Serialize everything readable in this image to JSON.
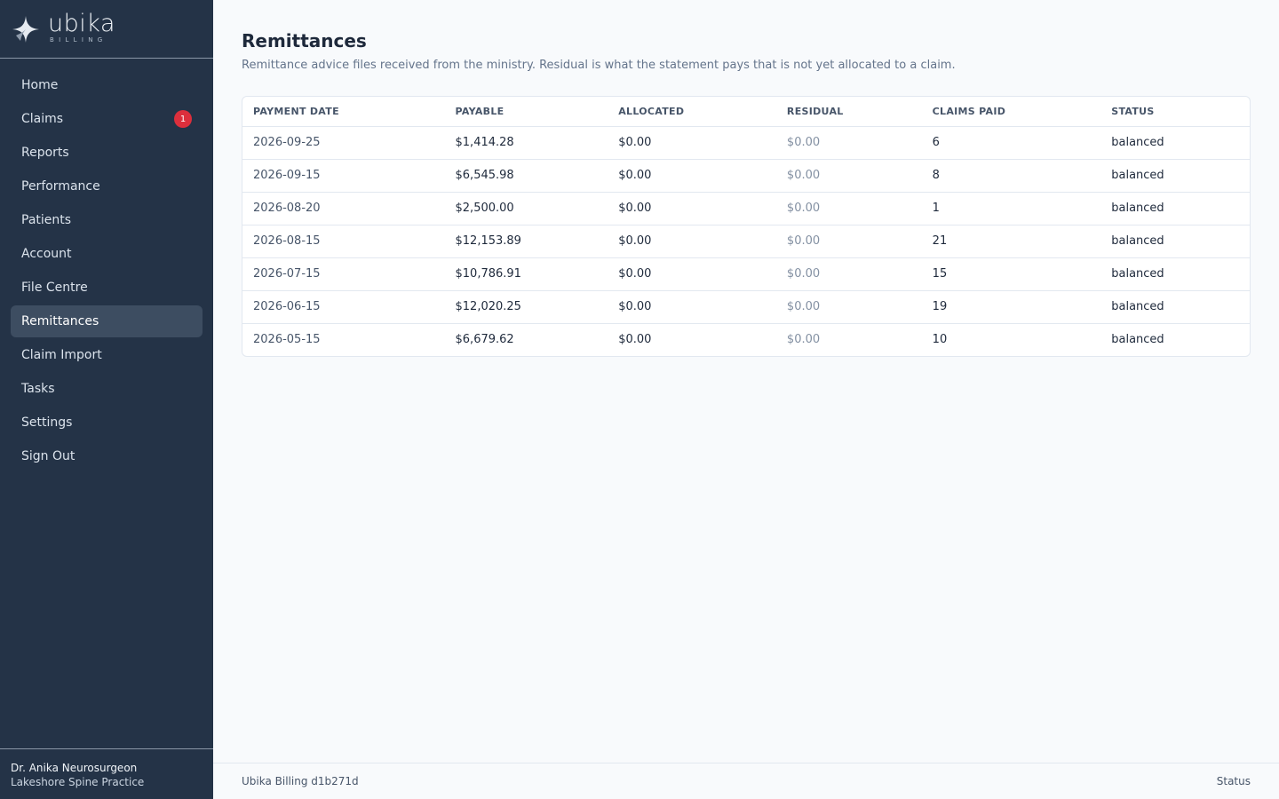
{
  "brand": {
    "name": "ubika",
    "sub": "BILLING"
  },
  "sidebar": {
    "items": [
      {
        "label": "Home",
        "name": "sidebar-item-home"
      },
      {
        "label": "Claims",
        "name": "sidebar-item-claims",
        "badge": "1"
      },
      {
        "label": "Reports",
        "name": "sidebar-item-reports"
      },
      {
        "label": "Performance",
        "name": "sidebar-item-performance"
      },
      {
        "label": "Patients",
        "name": "sidebar-item-patients"
      },
      {
        "label": "Account",
        "name": "sidebar-item-account"
      },
      {
        "label": "File Centre",
        "name": "sidebar-item-file-centre"
      },
      {
        "label": "Remittances",
        "name": "sidebar-item-remittances",
        "active": true
      },
      {
        "label": "Claim Import",
        "name": "sidebar-item-claim-import"
      },
      {
        "label": "Tasks",
        "name": "sidebar-item-tasks"
      },
      {
        "label": "Settings",
        "name": "sidebar-item-settings"
      },
      {
        "label": "Sign Out",
        "name": "sidebar-item-sign-out"
      }
    ]
  },
  "user": {
    "name": "Dr. Anika Neurosurgeon",
    "practice": "Lakeshore Spine Practice"
  },
  "page": {
    "title": "Remittances",
    "subtitle": "Remittance advice files received from the ministry. Residual is what the statement pays that is not yet allocated to a claim."
  },
  "table": {
    "columns": [
      "PAYMENT DATE",
      "PAYABLE",
      "ALLOCATED",
      "RESIDUAL",
      "CLAIMS PAID",
      "STATUS"
    ],
    "rows": [
      [
        "2026-09-25",
        "$1,414.28",
        "$0.00",
        "$0.00",
        "6",
        "balanced"
      ],
      [
        "2026-09-15",
        "$6,545.98",
        "$0.00",
        "$0.00",
        "8",
        "balanced"
      ],
      [
        "2026-08-20",
        "$2,500.00",
        "$0.00",
        "$0.00",
        "1",
        "balanced"
      ],
      [
        "2026-08-15",
        "$12,153.89",
        "$0.00",
        "$0.00",
        "21",
        "balanced"
      ],
      [
        "2026-07-15",
        "$10,786.91",
        "$0.00",
        "$0.00",
        "15",
        "balanced"
      ],
      [
        "2026-06-15",
        "$12,020.25",
        "$0.00",
        "$0.00",
        "19",
        "balanced"
      ],
      [
        "2026-05-15",
        "$6,679.62",
        "$0.00",
        "$0.00",
        "10",
        "balanced"
      ]
    ]
  },
  "footer": {
    "version": "Ubika Billing d1b271d",
    "status_link": "Status"
  },
  "colors": {
    "sidebar_bg": "#243347",
    "active_item": "#3d4d61",
    "badge": "#dc2f3c"
  }
}
